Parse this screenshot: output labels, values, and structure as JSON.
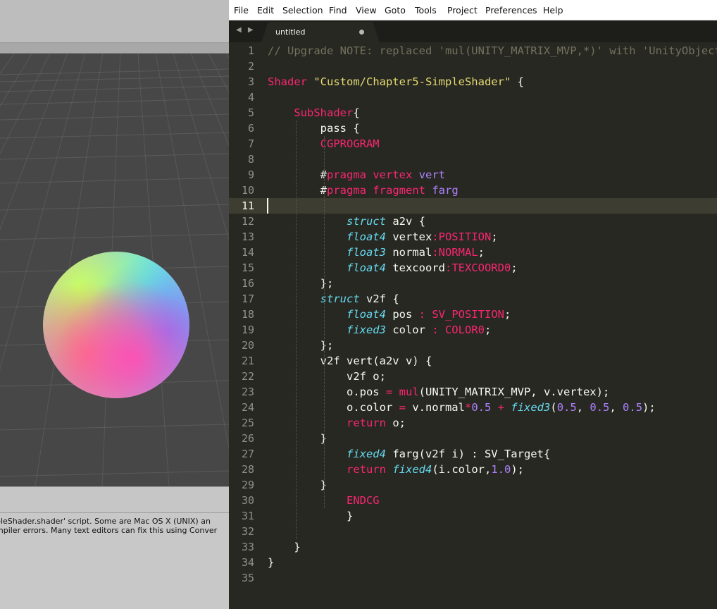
{
  "unity": {
    "console_lines": [
      "pleShader.shader' script. Some are Mac OS X (UNIX) an",
      "mpiler errors. Many text editors can fix this using Conver"
    ]
  },
  "editor": {
    "menu": [
      "File",
      "Edit",
      "Selection",
      "Find",
      "View",
      "Goto",
      "Tools",
      "Project",
      "Preferences",
      "Help"
    ],
    "tab_nav_arrows": "◀ ▶",
    "tab": {
      "label": "untitled",
      "modified": true
    },
    "current_line": 11,
    "lines": [
      [
        [
          "// Upgrade NOTE: replaced 'mul(UNITY_MATRIX_MVP,*)' with 'UnityObjectToClipPos(*)'",
          "cm"
        ]
      ],
      [],
      [
        [
          "Shader ",
          "kw"
        ],
        [
          "\"Custom/Chapter5-SimpleShader\"",
          "st"
        ],
        [
          " {",
          "pl"
        ]
      ],
      [],
      [
        [
          "    ",
          "pl"
        ],
        [
          "SubShader",
          "kw"
        ],
        [
          "{",
          "pl"
        ]
      ],
      [
        [
          "        pass {",
          "pl"
        ]
      ],
      [
        [
          "        ",
          "pl"
        ],
        [
          "CGPROGRAM",
          "kw"
        ]
      ],
      [],
      [
        [
          "        #",
          "pl"
        ],
        [
          "pragma",
          "kw"
        ],
        [
          " ",
          "pl"
        ],
        [
          "vertex",
          "kw"
        ],
        [
          " ",
          "pl"
        ],
        [
          "vert",
          "pu"
        ]
      ],
      [
        [
          "        #",
          "pl"
        ],
        [
          "pragma",
          "kw"
        ],
        [
          " ",
          "pl"
        ],
        [
          "fragment",
          "kw"
        ],
        [
          " ",
          "pl"
        ],
        [
          "farg",
          "pu"
        ]
      ],
      [],
      [
        [
          "            ",
          "pl"
        ],
        [
          "struct",
          "ty"
        ],
        [
          " a2v {",
          "pl"
        ]
      ],
      [
        [
          "            ",
          "pl"
        ],
        [
          "float4",
          "ty"
        ],
        [
          " vertex",
          "pl"
        ],
        [
          ":POSITION",
          "kw"
        ],
        [
          ";",
          "pl"
        ]
      ],
      [
        [
          "            ",
          "pl"
        ],
        [
          "float3",
          "ty"
        ],
        [
          " normal",
          "pl"
        ],
        [
          ":NORMAL",
          "kw"
        ],
        [
          ";",
          "pl"
        ]
      ],
      [
        [
          "            ",
          "pl"
        ],
        [
          "float4",
          "ty"
        ],
        [
          " texcoord",
          "pl"
        ],
        [
          ":TEXCOORD0",
          "kw"
        ],
        [
          ";",
          "pl"
        ]
      ],
      [
        [
          "        };",
          "pl"
        ]
      ],
      [
        [
          "        ",
          "pl"
        ],
        [
          "struct",
          "ty"
        ],
        [
          " v2f {",
          "pl"
        ]
      ],
      [
        [
          "            ",
          "pl"
        ],
        [
          "float4",
          "ty"
        ],
        [
          " pos ",
          "pl"
        ],
        [
          ": SV_POSITION",
          "kw"
        ],
        [
          ";",
          "pl"
        ]
      ],
      [
        [
          "            ",
          "pl"
        ],
        [
          "fixed3",
          "ty"
        ],
        [
          " color ",
          "pl"
        ],
        [
          ": COLOR0",
          "kw"
        ],
        [
          ";",
          "pl"
        ]
      ],
      [
        [
          "        };",
          "pl"
        ]
      ],
      [
        [
          "        v2f vert(a2v v) {",
          "pl"
        ]
      ],
      [
        [
          "            v2f o;",
          "pl"
        ]
      ],
      [
        [
          "            o.pos ",
          "pl"
        ],
        [
          "=",
          "kw"
        ],
        [
          " ",
          "pl"
        ],
        [
          "mul",
          "kw"
        ],
        [
          "(UNITY_MATRIX_MVP, v.vertex);",
          "pl"
        ]
      ],
      [
        [
          "            o.color ",
          "pl"
        ],
        [
          "=",
          "kw"
        ],
        [
          " v.normal",
          "pl"
        ],
        [
          "*",
          "kw"
        ],
        [
          "0.5",
          "nu"
        ],
        [
          " ",
          "pl"
        ],
        [
          "+",
          "kw"
        ],
        [
          " ",
          "pl"
        ],
        [
          "fixed3",
          "ty"
        ],
        [
          "(",
          "pl"
        ],
        [
          "0.5",
          "nu"
        ],
        [
          ", ",
          "pl"
        ],
        [
          "0.5",
          "nu"
        ],
        [
          ", ",
          "pl"
        ],
        [
          "0.5",
          "nu"
        ],
        [
          ");",
          "pl"
        ]
      ],
      [
        [
          "            ",
          "pl"
        ],
        [
          "return",
          "kw"
        ],
        [
          " o;",
          "pl"
        ]
      ],
      [
        [
          "        }",
          "pl"
        ]
      ],
      [
        [
          "            ",
          "pl"
        ],
        [
          "fixed4",
          "ty"
        ],
        [
          " farg(v2f i) : SV_Target{",
          "pl"
        ]
      ],
      [
        [
          "            ",
          "pl"
        ],
        [
          "return",
          "kw"
        ],
        [
          " ",
          "pl"
        ],
        [
          "fixed4",
          "ty"
        ],
        [
          "(i.color,",
          "pl"
        ],
        [
          "1.0",
          "nu"
        ],
        [
          ");",
          "pl"
        ]
      ],
      [
        [
          "        }",
          "pl"
        ]
      ],
      [
        [
          "            ",
          "pl"
        ],
        [
          "ENDCG",
          "kw"
        ]
      ],
      [
        [
          "            }",
          "pl"
        ]
      ],
      [],
      [
        [
          "    }",
          "pl"
        ]
      ],
      [
        [
          "}",
          "pl"
        ]
      ],
      []
    ]
  },
  "colors": {
    "editor_bg": "#272822",
    "keyword": "#f92672",
    "string": "#e6db74",
    "type": "#66d9ef",
    "number": "#ae81ff",
    "comment": "#75715e",
    "scene_bg": "#474747"
  }
}
